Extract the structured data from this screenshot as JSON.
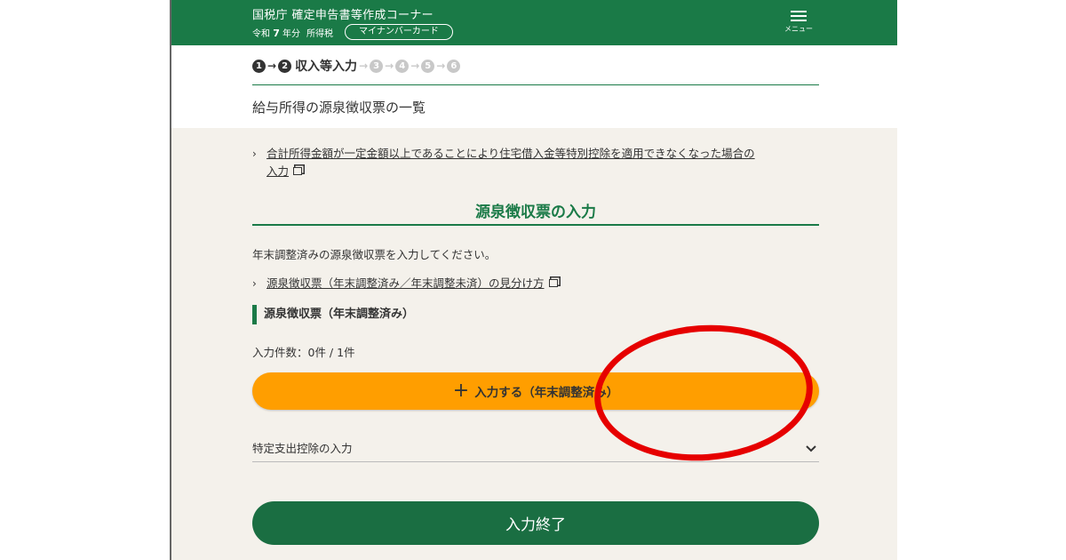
{
  "header": {
    "title": "国税庁 確定申告書等作成コーナー",
    "era_prefix": "令和",
    "year": "7",
    "year_suffix": "年分",
    "tax_type": "所得税",
    "auth_method": "マイナンバーカード",
    "menu_label": "メニュー"
  },
  "steps": {
    "items": [
      "1",
      "2",
      "3",
      "4",
      "5",
      "6"
    ],
    "current_index": 2,
    "current_label": "収入等入力"
  },
  "page_title": "給与所得の源泉徴収票の一覧",
  "links": {
    "housing_loan_line1": "合計所得金額が一定金額以上であることにより住宅借入金等特別控除を適用できなくなった場合の",
    "housing_loan_line2": "入力",
    "distinguish": "源泉徴収票（年末調整済み／年末調整未済）の見分け方"
  },
  "section": {
    "title": "源泉徴収票の入力",
    "description": "年末調整済みの源泉徴収票を入力してください。",
    "sub_heading": "源泉徴収票（年末調整済み）",
    "count_text": "入力件数：0件 / 1件",
    "add_button": "入力する（年末調整済み）",
    "special_expense": "特定支出控除の入力",
    "finish_button": "入力終了"
  },
  "colors": {
    "brand_green": "#1a7a47",
    "add_button": "#ff9e00",
    "annotation_red": "#e60000",
    "content_bg": "#f4f1eb"
  }
}
